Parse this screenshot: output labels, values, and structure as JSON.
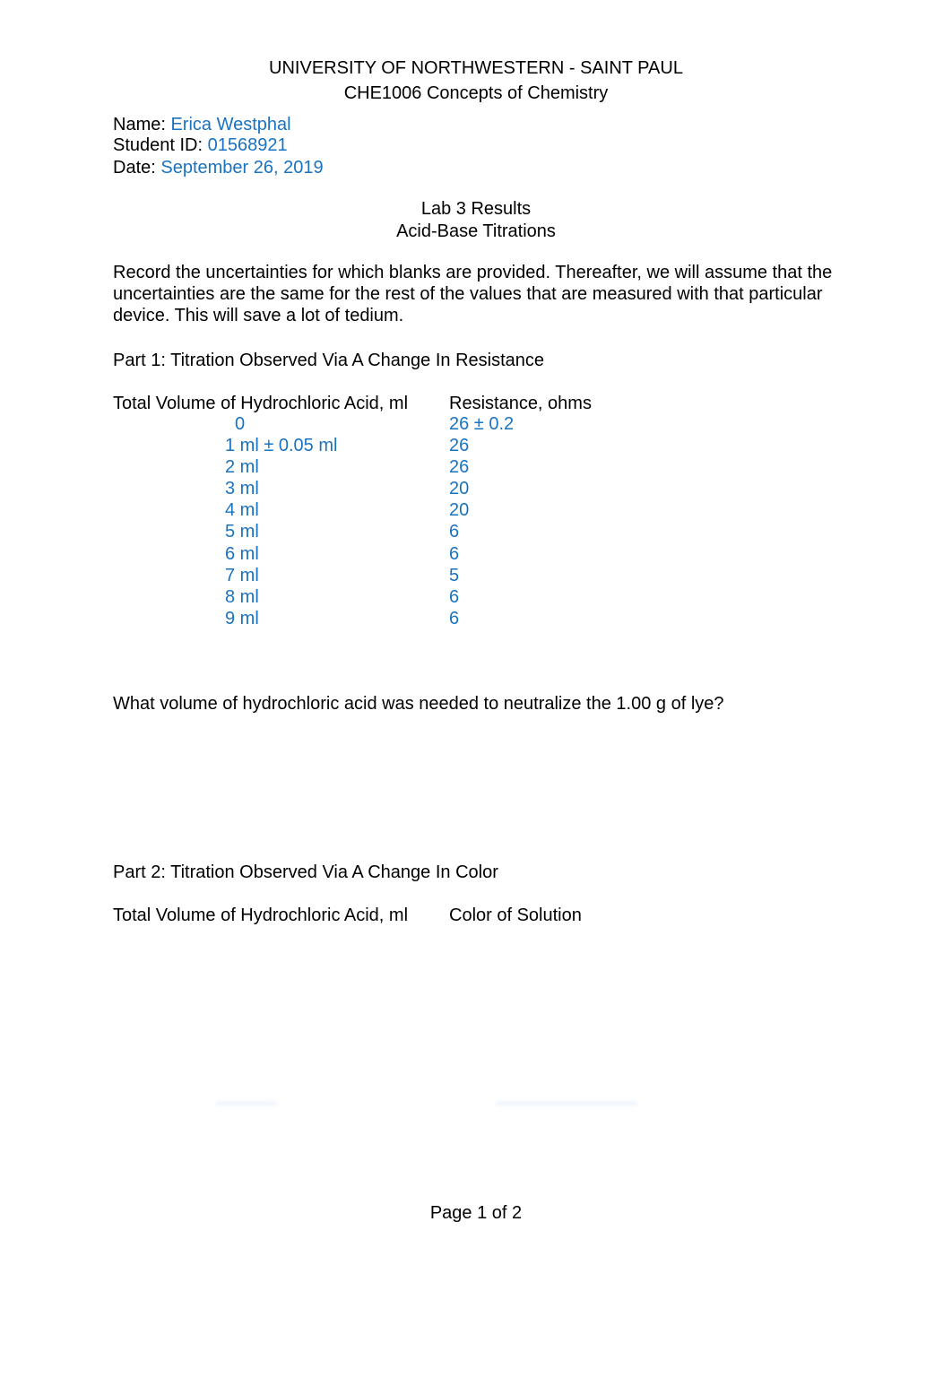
{
  "header": {
    "university": "UNIVERSITY OF NORTHWESTERN - SAINT PAUL",
    "course": "CHE1006 Concepts of Chemistry"
  },
  "student": {
    "name_label": "Name: ",
    "name_value": "Erica Westphal",
    "id_label": "Student ID: ",
    "id_value": "01568921",
    "date_label": "Date: ",
    "date_value": "September 26, 2019"
  },
  "title": {
    "line1": "Lab 3 Results",
    "line2": "Acid-Base Titrations"
  },
  "instructions": "Record the uncertainties for which blanks are provided. Thereafter, we will assume that the uncertainties are the same for the rest of the values that are measured with that particular device. This will save a lot of tedium.",
  "part1": {
    "heading": "Part 1: Titration Observed Via A Change In Resistance",
    "col1_header": "Total Volume of Hydrochloric Acid, ml",
    "col2_header": "Resistance, ohms",
    "rows": [
      {
        "volume": "0",
        "resistance": "26 ± 0.2"
      },
      {
        "volume": "1 ml ± 0.05 ml",
        "resistance": "26"
      },
      {
        "volume": "2 ml",
        "resistance": "26"
      },
      {
        "volume": "3 ml",
        "resistance": "20"
      },
      {
        "volume": "4 ml",
        "resistance": "20"
      },
      {
        "volume": "5 ml",
        "resistance": "6"
      },
      {
        "volume": "6 ml",
        "resistance": "6"
      },
      {
        "volume": "7 ml",
        "resistance": "5"
      },
      {
        "volume": "8 ml",
        "resistance": "6"
      },
      {
        "volume": "9 ml",
        "resistance": "6"
      }
    ],
    "question": "What volume of hydrochloric acid was needed to neutralize the 1.00 g of lye?"
  },
  "part2": {
    "heading": "Part 2: Titration Observed Via A Change In Color",
    "col1_header": "Total Volume of Hydrochloric Acid, ml",
    "col2_header": "Color of Solution"
  },
  "footer": {
    "page": "Page 1 of 2"
  }
}
